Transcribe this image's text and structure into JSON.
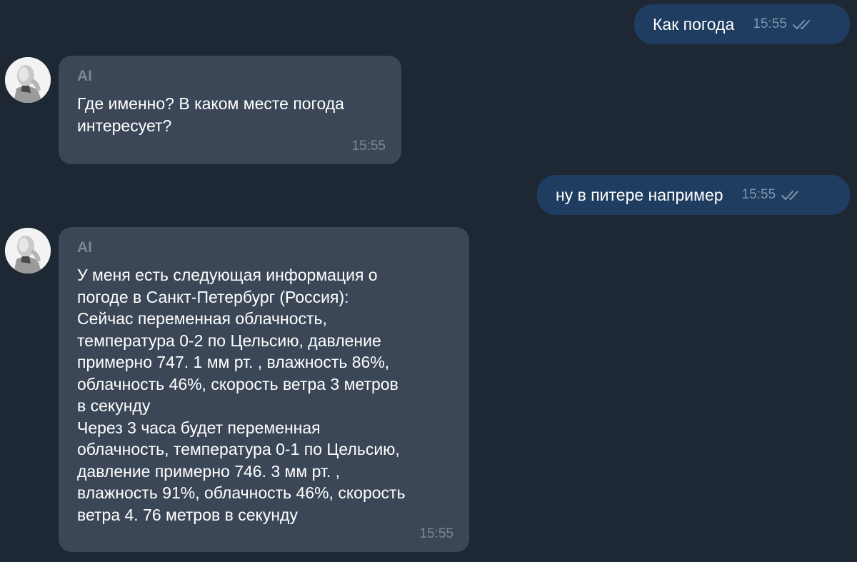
{
  "messages": [
    {
      "direction": "outgoing",
      "text": "Как погода",
      "time": "15:55",
      "status_icon": "double-check-icon"
    },
    {
      "direction": "incoming",
      "sender": "AI",
      "text": "Где именно? В каком месте погода\nинтересует?",
      "time": "15:55",
      "avatar_icon": "robot-avatar"
    },
    {
      "direction": "outgoing",
      "text": "ну в питере например",
      "time": "15:55",
      "status_icon": "double-check-icon"
    },
    {
      "direction": "incoming",
      "sender": "AI",
      "text": "У меня есть следующая информация о\nпогоде в Санкт-Петербург (Россия):\nСейчас переменная облачность,\nтемпература 0-2 по Цельсию, давление\nпримерно 747. 1 мм рт. , влажность 86%,\nоблачность 46%, скорость ветра 3 метров\nв секунду\nЧерез 3 часа будет переменная\nоблачность, температура 0-1 по Цельсию,\nдавление примерно 746. 3 мм рт. ,\nвлажность 91%, облачность 46%, скорость\nветра 4. 76 метров в секунду",
      "time": "15:55",
      "avatar_icon": "robot-avatar"
    }
  ],
  "colors": {
    "background": "#1e2734",
    "outgoing_bubble": "#1f3d60",
    "incoming_bubble": "#3b4757",
    "meta_text": "#7b8797"
  }
}
